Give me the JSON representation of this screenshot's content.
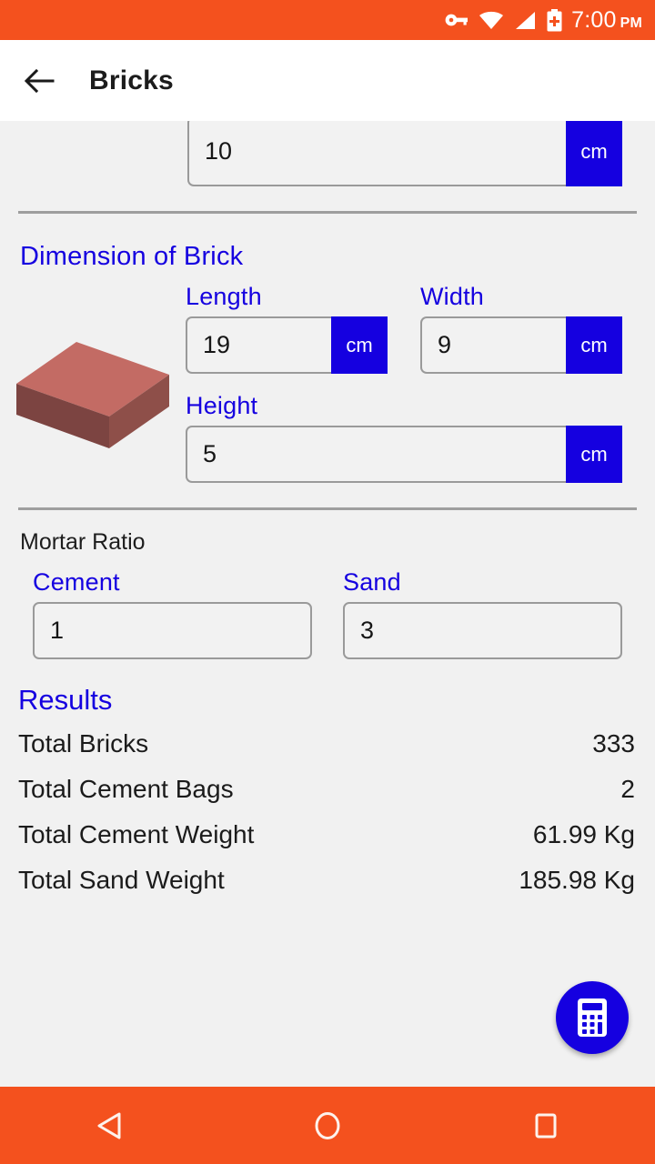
{
  "status_bar": {
    "time": "7:00",
    "ampm": "PM",
    "icons": [
      "vpn-key-icon",
      "wifi-icon",
      "cellular-signal-icon",
      "battery-charging-icon"
    ],
    "background_color": "#f4511e"
  },
  "app_bar": {
    "back_label": "back-arrow",
    "title": "Bricks",
    "background_color": "#ffffff"
  },
  "top_field": {
    "value": "10",
    "unit": "cm"
  },
  "brick_section": {
    "title": "Dimension of Brick",
    "illustration": "brick-3d-illustration",
    "fields": [
      {
        "label": "Length",
        "value": "19",
        "unit": "cm"
      },
      {
        "label": "Width",
        "value": "9",
        "unit": "cm"
      },
      {
        "label": "Height",
        "value": "5",
        "unit": "cm"
      }
    ]
  },
  "mortar_section": {
    "title": "Mortar Ratio",
    "fields": [
      {
        "label": "Cement",
        "value": "1"
      },
      {
        "label": "Sand",
        "value": "3"
      }
    ]
  },
  "results": {
    "title": "Results",
    "rows": [
      {
        "label": "Total Bricks",
        "value": "333"
      },
      {
        "label": "Total Cement Bags",
        "value": "2"
      },
      {
        "label": "Total Cement Weight",
        "value": "61.99 Kg"
      },
      {
        "label": "Total Sand Weight",
        "value": "185.98 Kg"
      }
    ]
  },
  "fab": {
    "icon": "calculator-icon",
    "color": "#1500e0"
  },
  "nav_bar": {
    "buttons": [
      "back-triangle-icon",
      "home-circle-icon",
      "recents-square-icon"
    ],
    "background_color": "#f4511e"
  },
  "theme": {
    "accent_blue": "#1500e0",
    "orange": "#f4511e",
    "page_background": "#f1f1f1"
  }
}
